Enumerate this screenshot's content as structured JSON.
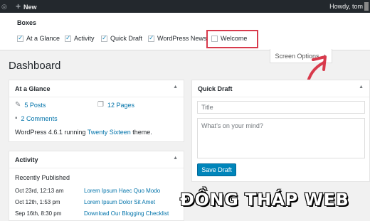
{
  "admin_bar": {
    "new_label": "New",
    "howdy": "Howdy, tom"
  },
  "screen_options": {
    "boxes_title": "Boxes",
    "options": [
      {
        "label": "At a Glance",
        "checked": true
      },
      {
        "label": "Activity",
        "checked": true
      },
      {
        "label": "Quick Draft",
        "checked": true
      },
      {
        "label": "WordPress News",
        "checked": true
      },
      {
        "label": "Welcome",
        "checked": false
      }
    ],
    "tab_label": "Screen Options",
    "highlight_color": "#d83a4c"
  },
  "page_title": "Dashboard",
  "at_a_glance": {
    "title": "At a Glance",
    "posts": "5 Posts",
    "pages": "12 Pages",
    "comments": "2 Comments",
    "version_prefix": "WordPress 4.6.1 running",
    "theme": "Twenty Sixteen",
    "version_suffix": "theme."
  },
  "activity": {
    "title": "Activity",
    "recent_title": "Recently Published",
    "rows": [
      {
        "date": "Oct 23rd, 12:13 am",
        "title": "Lorem Ipsum Haec Quo Modo"
      },
      {
        "date": "Oct 12th, 1:53 pm",
        "title": "Lorem Ipsum Dolor Sit Amet"
      },
      {
        "date": "Sep 16th, 8:30 pm",
        "title": "Download Our Blogging Checklist"
      }
    ]
  },
  "quick_draft": {
    "title": "Quick Draft",
    "title_placeholder": "Title",
    "content_placeholder": "What’s on your mind?",
    "save_label": "Save Draft"
  },
  "watermark": "ĐỒNG THÁP WEB",
  "colors": {
    "link": "#0073aa",
    "button": "#0085ba",
    "admin_bar": "#23282d"
  }
}
